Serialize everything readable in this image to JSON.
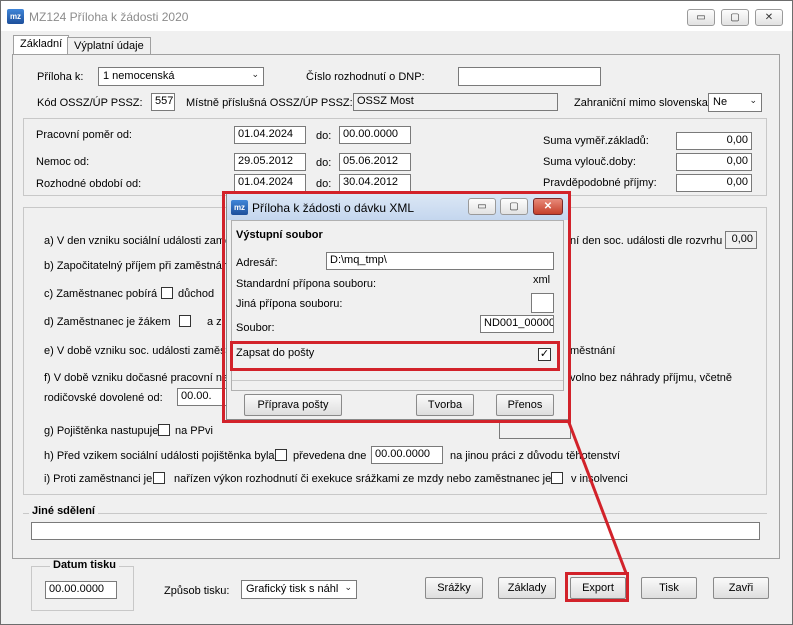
{
  "window": {
    "title": "MZ124 Příloha k žádosti 2020",
    "icon": "mz"
  },
  "titlebar_buttons": {
    "minimize": "▭",
    "restore": "▢",
    "close": "✕"
  },
  "tabs": [
    {
      "label": "Základní"
    },
    {
      "label": "Výplatní údaje"
    }
  ],
  "header": {
    "priloha_label": "Příloha k:",
    "priloha_value": "1 nemocenská",
    "cislo_label": "Číslo rozhodnutí o DNP:",
    "cislo_value": "",
    "kod_label": "Kód OSSZ/ÚP PSSZ:",
    "kod_value": "557",
    "mistne_label": "Místně příslušná OSSZ/ÚP PSSZ:",
    "mistne_value": "OSSZ Most",
    "zahranicni_label": "Zahraniční mimo slovenska:",
    "zahranicni_value": "Ne"
  },
  "periods": {
    "pracovni_label": "Pracovní poměr od:",
    "pracovni_od": "01.04.2024",
    "do_label": "do:",
    "pracovni_do": "00.00.0000",
    "nemoc_label": "Nemoc od:",
    "nemoc_od": "29.05.2012",
    "nemoc_do": "05.06.2012",
    "rozhodne_label": "Rozhodné období od:",
    "rozhodne_od": "01.04.2024",
    "rozhodne_do": "30.04.2012",
    "suma_vymer_label": "Suma vyměř.základů:",
    "suma_vymer_value": "0,00",
    "suma_vylouc_label": "Suma vylouč.doby:",
    "suma_vylouc_value": "0,00",
    "pravdepodobne_label": "Pravděpodobné příjmy:",
    "pravdepodobne_value": "0,00"
  },
  "questions": {
    "a_text": "a) V den vzniku sociální události zamě",
    "a_right": "ní den soc. události dle rozvrhu",
    "a_value": "0,00",
    "b_text": "b) Započitatelný příjem při zaměstnání",
    "c_text": "c) Zaměstnanec pobírá",
    "c_opt": "důchod",
    "d_text": "d) Zaměstnanec je žákem",
    "d_opt": "a z",
    "e_text": "e) V době vzniku soc. události zaměst",
    "e_right": "městnání",
    "f_text": "f) V době vzniku dočasné pracovní ne",
    "f_right": "volno bez náhrady příjmu, včetně",
    "f_text2": "rodičovské dovolené  od:",
    "f_value": "00.00.",
    "g_text": "g) Pojištěnka nastupuje",
    "g_opt": "na PPvi",
    "h_text": "h) Před vzikem sociální události pojištěnka byla",
    "h_opt": "převedena dne",
    "h_value": "00.00.0000",
    "h_right": "na jinou práci z důvodu těhotenství",
    "i_text": "i) Proti zaměstnanci je",
    "i_opt": "nařízen výkon rozhodnutí či exekuce srážkami ze mzdy nebo zaměstnanec je",
    "i_right": "v insolvenci"
  },
  "jine": {
    "title": "Jiné sdělení",
    "value": ""
  },
  "footer": {
    "datum_title": "Datum tisku",
    "datum_value": "00.00.0000",
    "zpusob_label": "Způsob tisku:",
    "zpusob_value": "Grafický tisk s náhl",
    "srazky": "Srážky",
    "zaklady": "Základy",
    "export": "Export",
    "tisk": "Tisk",
    "zavri": "Zavři"
  },
  "dialog": {
    "title": "Příloha k žádosti o dávku XML",
    "section": "Výstupní soubor",
    "adresar_label": "Adresář:",
    "adresar_value": "D:\\mq_tmp\\",
    "std_label": "Standardní přípona souboru:",
    "std_value": "xml",
    "jina_label": "Jiná přípona souboru:",
    "jina_value": "",
    "soubor_label": "Soubor:",
    "soubor_value": "ND001_00000",
    "posta_label": "Zapsat do pošty",
    "posta_checked": "✓",
    "priprava": "Příprava pošty",
    "tvorba": "Tvorba",
    "prenos": "Přenos"
  },
  "accent": {
    "highlight_red": "#d2222a",
    "dialog_title_bg": "#c4d6ee"
  }
}
